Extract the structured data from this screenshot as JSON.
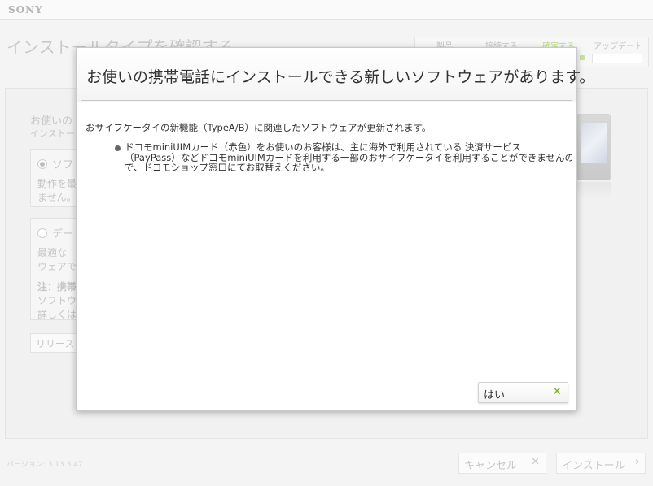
{
  "app": {
    "logo": "SONY"
  },
  "background": {
    "title": "インストールタイプを確認する",
    "steps": [
      {
        "label": "製品",
        "state": "done"
      },
      {
        "label": "接続する",
        "state": "done"
      },
      {
        "label": "確定する",
        "state": "current"
      },
      {
        "label": "アップデート",
        "state": "todo"
      }
    ],
    "heading_partial": "お使いの",
    "subheading_partial": "インストー",
    "option1": {
      "label_partial": "ソフ",
      "desc_lines": [
        "動作を最",
        "ません。"
      ]
    },
    "option2": {
      "label_partial": "デー",
      "desc_lines": [
        "最適な",
        "ウェアで"
      ],
      "note_lines": [
        "注：携帯",
        "ソフトウ",
        "詳しくは"
      ]
    },
    "release_button": "リリースノ",
    "version": "バージョン: 3.13.3.47",
    "cancel_button": "キャンセル",
    "install_button": "インストール"
  },
  "dialog": {
    "title": "お使いの携帯電話にインストールできる新しいソフトウェアがあります。",
    "intro": "おサイフケータイの新機能（TypeA/B）に関連したソフトウェアが更新されます。",
    "bullet_lines": [
      "ドコモminiUIMカード（赤色）をお使いのお客様は、主に海外で利用されている 決済サービス",
      "（PayPass）などドコモminiUIMカードを利用する一部のおサイフケータイを利用することができませんので",
      "で、ドコモショップ窓口にてお取替えください。"
    ],
    "ok_button": "はい"
  },
  "colors": {
    "accent": "#7ab52b",
    "step_current": "#b9dc8a"
  },
  "icons": {
    "close": "close-x-icon",
    "forward": "chevron-right-icon"
  }
}
